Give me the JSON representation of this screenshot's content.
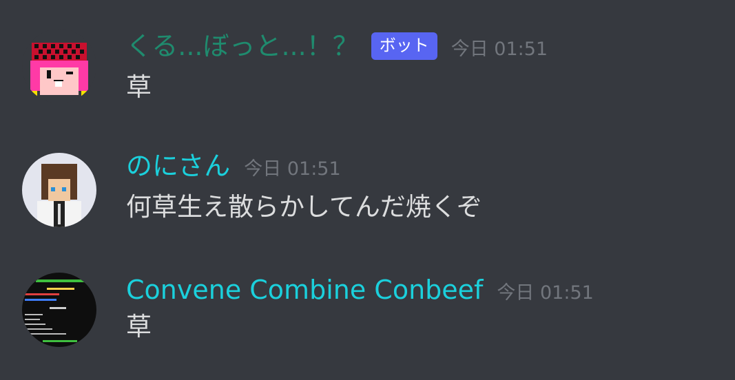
{
  "messages": [
    {
      "username": "くる...ぼっと...！？",
      "username_color": "#1f8b6e",
      "bot_tag": "ボット",
      "timestamp": "今日 01:51",
      "content": "草",
      "avatar_icon": "pixel-girl-avatar-icon"
    },
    {
      "username": "のにさん",
      "username_color": "#1bd0dc",
      "timestamp": "今日 01:51",
      "content": "何草生え散らかしてんだ焼くぞ",
      "avatar_icon": "pixel-boy-avatar-icon"
    },
    {
      "username": "Convene Combine Conbeef",
      "username_color": "#1bd0dc",
      "timestamp": "今日 01:51",
      "content": "草",
      "avatar_icon": "game-scoreboard-avatar-icon"
    }
  ],
  "colors": {
    "background": "#36393f",
    "bot_tag_bg": "#5865f2",
    "timestamp": "#72767d",
    "content_text": "#dcddde"
  }
}
